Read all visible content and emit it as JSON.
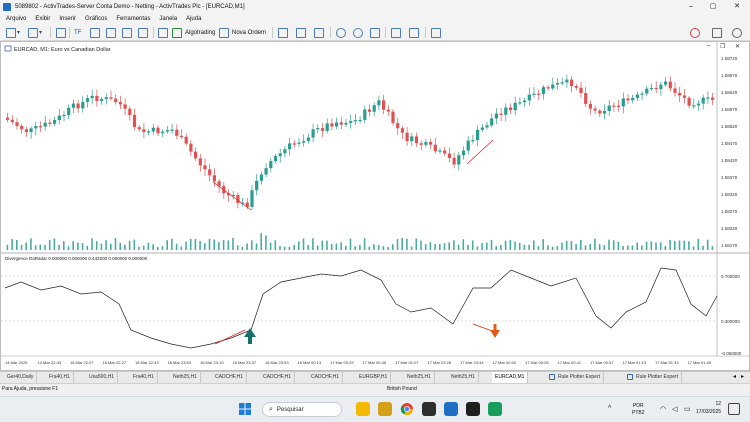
{
  "window": {
    "title": "5089802 - ActivTrades-Server Conta Demo - Netting - ActivTrades Plc - [EURCAD,M1]"
  },
  "menu": [
    "Arquivo",
    "Exibir",
    "Inserir",
    "Gráficos",
    "Ferramentas",
    "Janela",
    "Ajuda"
  ],
  "toolbar": {
    "algotrading_label": "Algotrading",
    "new_order_label": "Nova Ordem",
    "tf_label": "TF"
  },
  "chart": {
    "label": "EURCAD, M1:  Euro vs Canadian Dollar",
    "price_ticks": [
      "1.58720",
      "1.58670",
      "1.58620",
      "1.58570",
      "1.58520",
      "1.58470",
      "1.58420",
      "1.58370",
      "1.58320",
      "1.58270",
      "1.58220",
      "1.58170"
    ],
    "indicator_label": "Divergence DaRadar 0.000000 0.000000 0.442000 0.000000 0.000000",
    "indicator_ticks": [
      "0.700000",
      "0.300000",
      "-0.050000"
    ],
    "time_ticks": [
      "14 Mar 2025",
      "14 Mar 22:43",
      "16 Mar 22:07",
      "16 Mar 22:27",
      "16 Mar 22:43",
      "16 Mar 23:03",
      "16 Mar 23:19",
      "16 Mar 23:37",
      "16 Mar 23:53",
      "16 Mar 00:13",
      "17 Mar 00:29",
      "17 Mar 00:45",
      "17 Mar 01:07",
      "17 Mar 23:28",
      "17 Mar 23:44",
      "17 Mar 00:00",
      "17 Mar 00:25",
      "17 Mar 00:41",
      "17 Mar 00:57",
      "17 Mar 01:13",
      "17 Mar 01:33",
      "17 Mar 01:49"
    ]
  },
  "tabs": [
    "Ger40,Daily",
    "Fra40,H1",
    "Usa500,H1",
    "Fra40,H1",
    "Neth25,H1",
    "CADCHF,H1",
    "CADCHF,H1",
    "CADCHF,H1",
    "EURGBP,H1",
    "Neth25,H1",
    "Neth25,H1",
    "EURCAD,M1",
    "Rule Plotter Expert",
    "Rule Plotter Expert"
  ],
  "status": {
    "help": "Para Ajuda, pressione F1",
    "pound": "British Pound"
  },
  "taskbar": {
    "search_placeholder": "Pesquisar",
    "lang_top": "POR",
    "lang_bottom": "PTB2",
    "date": "17/03/2025",
    "time_partial": "12"
  },
  "colors": {
    "bull": "#2a9d8f",
    "bear": "#e05252",
    "arrow_up": "#15706a",
    "arrow_down": "#e05a1a"
  }
}
